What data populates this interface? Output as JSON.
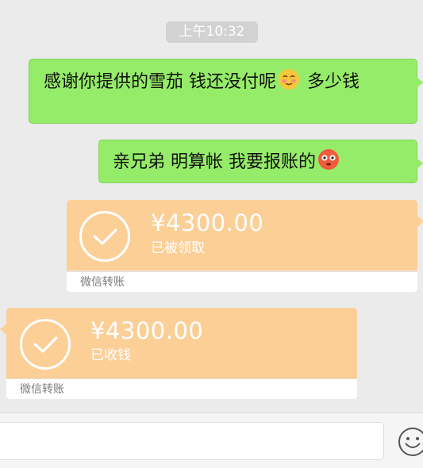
{
  "timestamp": "上午10:32",
  "messages": [
    {
      "id": "msg1",
      "side": "right",
      "text_before_emoji": "感谢你提供的雪茄 钱还没付呢",
      "emoji": "blushing-face-emoji",
      "text_after_emoji": " 多少钱"
    },
    {
      "id": "msg2",
      "side": "right",
      "text_before_emoji": "亲兄弟 明算帐 我要报账的",
      "emoji": "flushed-face-emoji"
    }
  ],
  "transfers": [
    {
      "side": "right",
      "amount": "¥4300.00",
      "status": "已被领取",
      "footer": "微信转账",
      "icon": "check-circle-icon"
    },
    {
      "side": "left",
      "amount": "¥4300.00",
      "status": "已收钱",
      "footer": "微信转账",
      "icon": "check-circle-icon"
    }
  ],
  "input_bar": {
    "value": "",
    "emoji_icon": "smiley-face-icon"
  },
  "colors": {
    "background": "#ebebeb",
    "bubble_green": "#95ec69",
    "transfer_orange": "#fccf97",
    "timestamp_pill": "#d2d2d2"
  }
}
